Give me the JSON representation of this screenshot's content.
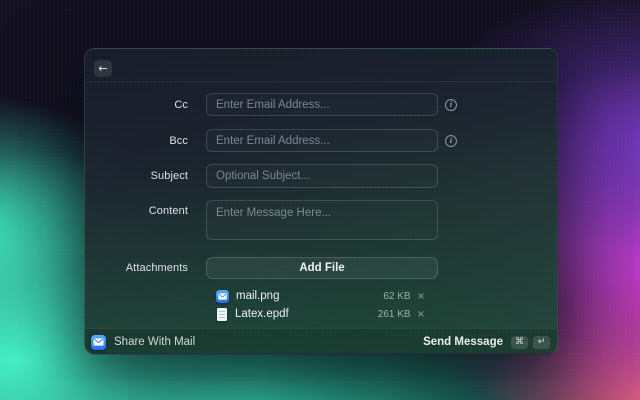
{
  "window": {
    "header": {
      "back_icon": "←"
    },
    "fields": {
      "cc": {
        "label": "Cc",
        "placeholder": "Enter Email Address..."
      },
      "bcc": {
        "label": "Bcc",
        "placeholder": "Enter Email Address..."
      },
      "subject": {
        "label": "Subject",
        "placeholder": "Optional Subject..."
      },
      "content": {
        "label": "Content",
        "placeholder": "Enter Message Here..."
      }
    },
    "info_icon_glyph": "i",
    "attachments": {
      "label": "Attachments",
      "add_file_button": "Add File",
      "files": [
        {
          "icon": "mail-app-icon",
          "name": "mail.png",
          "size": "62 KB",
          "remove_glyph": "×"
        },
        {
          "icon": "document-icon",
          "name": "Latex.epdf",
          "size": "261 KB",
          "remove_glyph": "×"
        }
      ]
    },
    "footer": {
      "app_icon": "mail-app-icon",
      "app_title": "Share With Mail",
      "send_button_label": "Send Message",
      "shortcut_keys": [
        "⌘",
        "↵"
      ]
    }
  },
  "colors": {
    "accent_mint": "#3df0c4",
    "accent_magenta": "#e13fd9",
    "accent_purple": "#743cd0",
    "accent_coral": "#f67c69",
    "mail_icon_blue": "#1f6ff2",
    "window_top": "#191d2a",
    "window_bottom": "#1f4737"
  }
}
